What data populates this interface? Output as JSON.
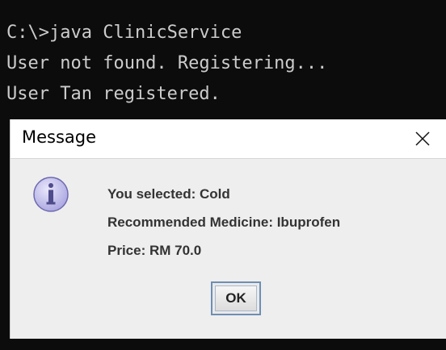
{
  "console": {
    "lines": [
      "C:\\>java ClinicService",
      "User not found. Registering...",
      "User Tan registered."
    ]
  },
  "dialog": {
    "title": "Message",
    "close_symbol": "×",
    "icon": "info-icon",
    "messages": [
      "You selected: Cold",
      "Recommended Medicine: Ibuprofen",
      "Price: RM 70.0"
    ],
    "ok_label": "OK"
  },
  "colors": {
    "console_bg": "#0c0c0c",
    "console_text": "#cccccc",
    "dialog_bg": "#eeeeee",
    "message_text": "#333333",
    "icon_fill": "#b7b4e8"
  }
}
